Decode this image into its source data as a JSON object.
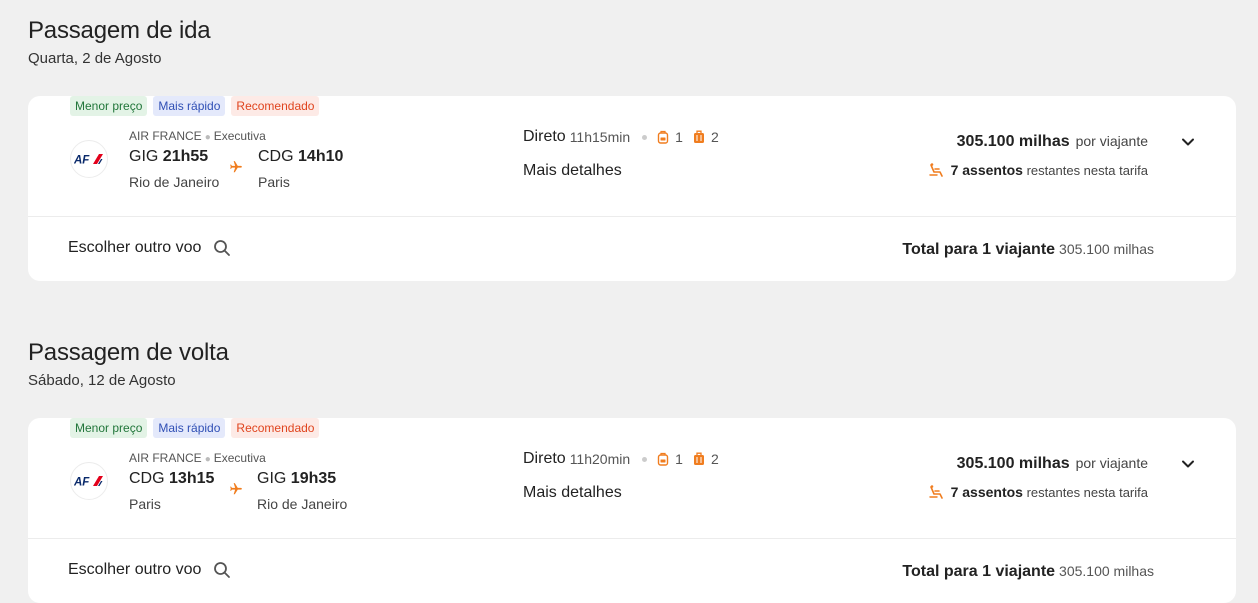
{
  "sections": [
    {
      "title": "Passagem de ida",
      "date": "Quarta, 2 de Agosto",
      "badges": [
        "Menor preço",
        "Mais rápido",
        "Recomendado"
      ],
      "airline": "AIR FRANCE",
      "cabin": "Executiva",
      "logo_text": "AF",
      "origin": {
        "code": "GIG",
        "time": "21h55",
        "city": "Rio de Janeiro"
      },
      "destination": {
        "code": "CDG",
        "time": "14h10",
        "city": "Paris"
      },
      "stops": "Direto",
      "duration": "11h15min",
      "carry_on": "1",
      "checked": "2",
      "details_label": "Mais detalhes",
      "price": "305.100 milhas",
      "per_traveler": "por viajante",
      "seats_count": "7 assentos",
      "seats_text": "restantes nesta tarifa",
      "other_flight": "Escolher outro voo",
      "total_label": "Total para 1 viajante",
      "total_value": "305.100 milhas"
    },
    {
      "title": "Passagem de volta",
      "date": "Sábado, 12 de Agosto",
      "badges": [
        "Menor preço",
        "Mais rápido",
        "Recomendado"
      ],
      "airline": "AIR FRANCE",
      "cabin": "Executiva",
      "logo_text": "AF",
      "origin": {
        "code": "CDG",
        "time": "13h15",
        "city": "Paris"
      },
      "destination": {
        "code": "GIG",
        "time": "19h35",
        "city": "Rio de Janeiro"
      },
      "stops": "Direto",
      "duration": "11h20min",
      "carry_on": "1",
      "checked": "2",
      "details_label": "Mais detalhes",
      "price": "305.100 milhas",
      "per_traveler": "por viajante",
      "seats_count": "7 assentos",
      "seats_text": "restantes nesta tarifa",
      "other_flight": "Escolher outro voo",
      "total_label": "Total para 1 viajante",
      "total_value": "305.100 milhas"
    }
  ],
  "colors": {
    "accent": "#f07d1f",
    "airfrance_blue": "#0a2a6b",
    "airfrance_red": "#e3001b"
  }
}
